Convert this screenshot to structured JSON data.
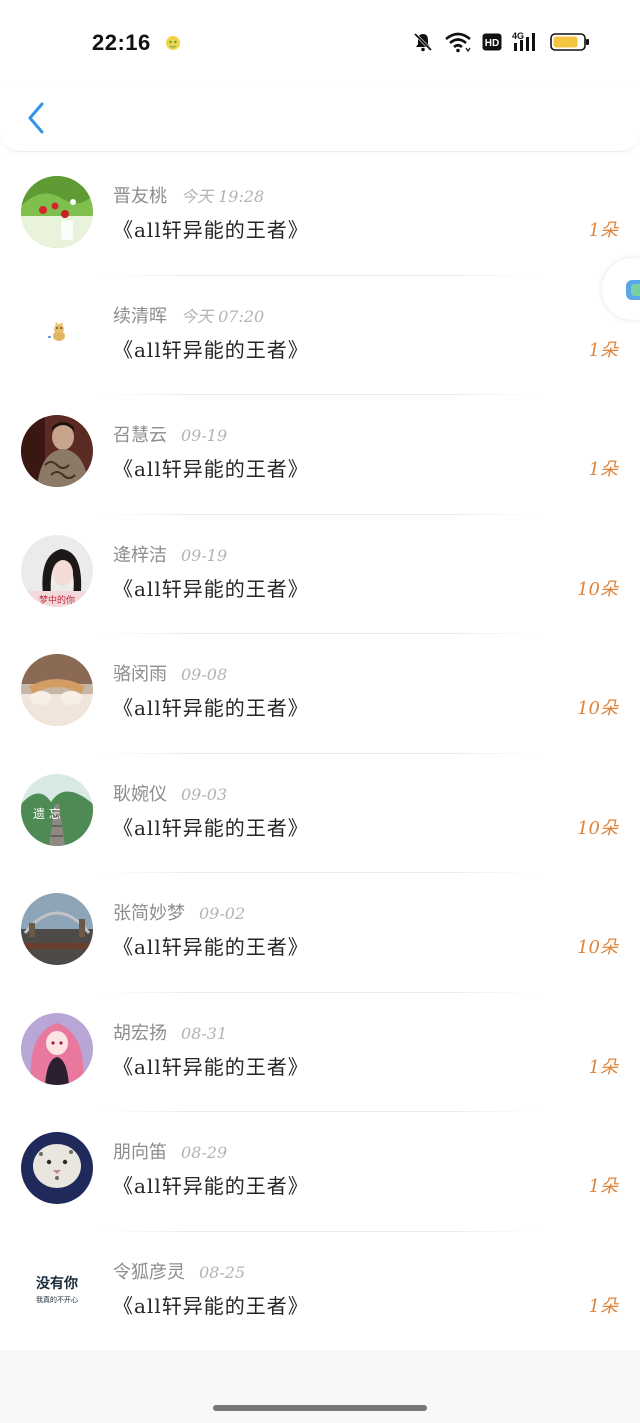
{
  "status_bar": {
    "time": "22:16",
    "network": "4G",
    "hd_label": "HD",
    "icons": [
      "notification-pet-icon",
      "mute-icon",
      "wifi-icon",
      "hd-icon",
      "signal-icon",
      "battery-icon"
    ],
    "battery_color": "#f5c542"
  },
  "nav": {
    "back_icon": "chevron-left-icon",
    "accent_color": "#2f94e8"
  },
  "gift_list": [
    {
      "name": "晋友桃",
      "date": "今天 19:28",
      "book": "《all轩异能的王者》",
      "count": "1朵",
      "avatar": "strawberry-flower"
    },
    {
      "name": "续清晖",
      "date": "今天 07:20",
      "book": "《all轩异能的王者》",
      "count": "1朵",
      "avatar": "small-cat"
    },
    {
      "name": "召慧云",
      "date": "09-19",
      "book": "《all轩异能的王者》",
      "count": "1朵",
      "avatar": "tattooed-man"
    },
    {
      "name": "逄梓洁",
      "date": "09-19",
      "book": "《all轩异能的王者》",
      "count": "10朵",
      "avatar": "girl-portrait",
      "avatar_text": "梦中的你"
    },
    {
      "name": "骆闵雨",
      "date": "09-08",
      "book": "《all轩异能的王者》",
      "count": "10朵",
      "avatar": "cat-paws"
    },
    {
      "name": "耿婉仪",
      "date": "09-03",
      "book": "《all轩异能的王者》",
      "count": "10朵",
      "avatar": "railway",
      "avatar_text": "遗 忘"
    },
    {
      "name": "张简妙梦",
      "date": "09-02",
      "book": "《all轩异能的王者》",
      "count": "10朵",
      "avatar": "city-bridge"
    },
    {
      "name": "胡宏扬",
      "date": "08-31",
      "book": "《all轩异能的王者》",
      "count": "1朵",
      "avatar": "anime-girl"
    },
    {
      "name": "朋向笛",
      "date": "08-29",
      "book": "《all轩异能的王者》",
      "count": "1朵",
      "avatar": "snow-leopard"
    },
    {
      "name": "令狐彦灵",
      "date": "08-25",
      "book": "《all轩异能的王者》",
      "count": "1朵",
      "avatar": "text-avatar",
      "avatar_text": "没有你",
      "avatar_subtext": "我真的不开心"
    }
  ],
  "floating_button": {
    "icon": "chat-bubble-icon"
  },
  "colors": {
    "count": "#e0843a",
    "meta": "#8d8d8d"
  }
}
